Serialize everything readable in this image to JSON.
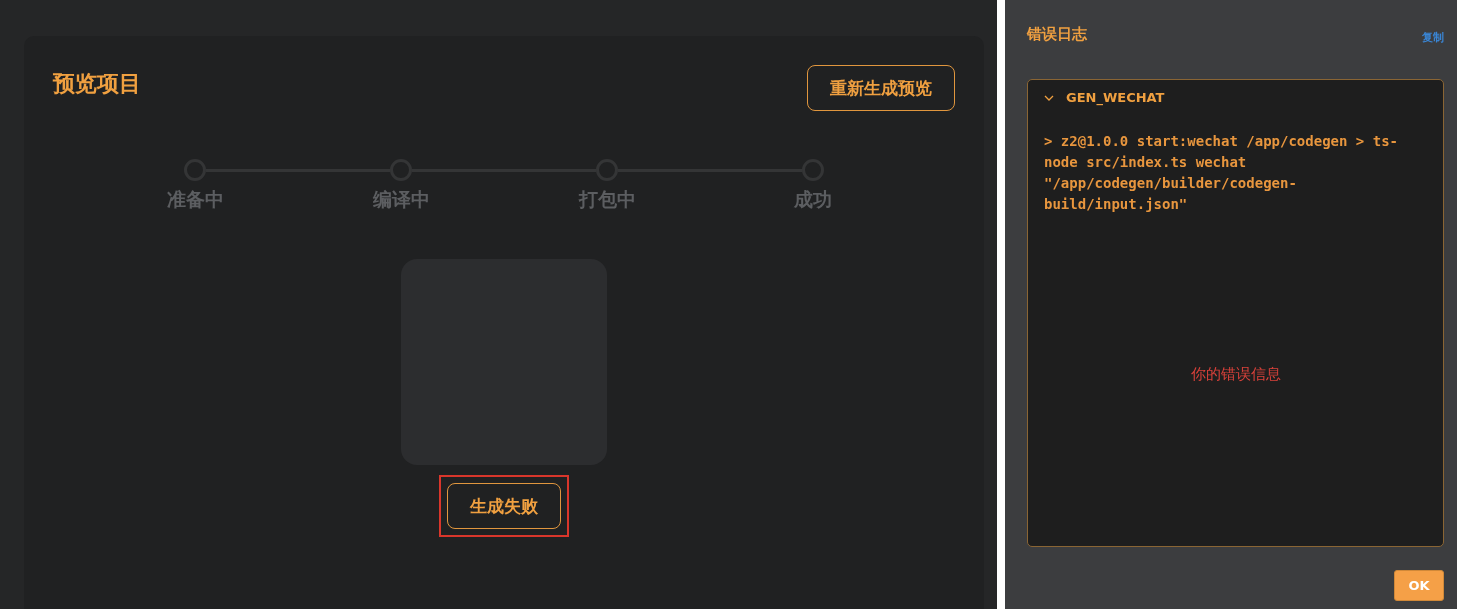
{
  "preview": {
    "title": "预览项目",
    "regenerate_button": "重新生成预览",
    "steps": [
      {
        "label": "准备中",
        "done": false
      },
      {
        "label": "编译中",
        "done": false
      },
      {
        "label": "打包中",
        "done": false
      },
      {
        "label": "成功",
        "done": false
      }
    ],
    "status_button": {
      "label": "生成失败",
      "highlighted": true
    }
  },
  "error_log": {
    "title": "错误日志",
    "copy_link": "复制",
    "section": {
      "title": "GEN_WECHAT",
      "expanded": true,
      "output": "> z2@1.0.0 start:wechat /app/codegen > ts-node src/index.ts wechat \"/app/codegen/builder/codegen-build/input.json\"",
      "message": "你的错误信息"
    },
    "ok_button": "OK"
  }
}
